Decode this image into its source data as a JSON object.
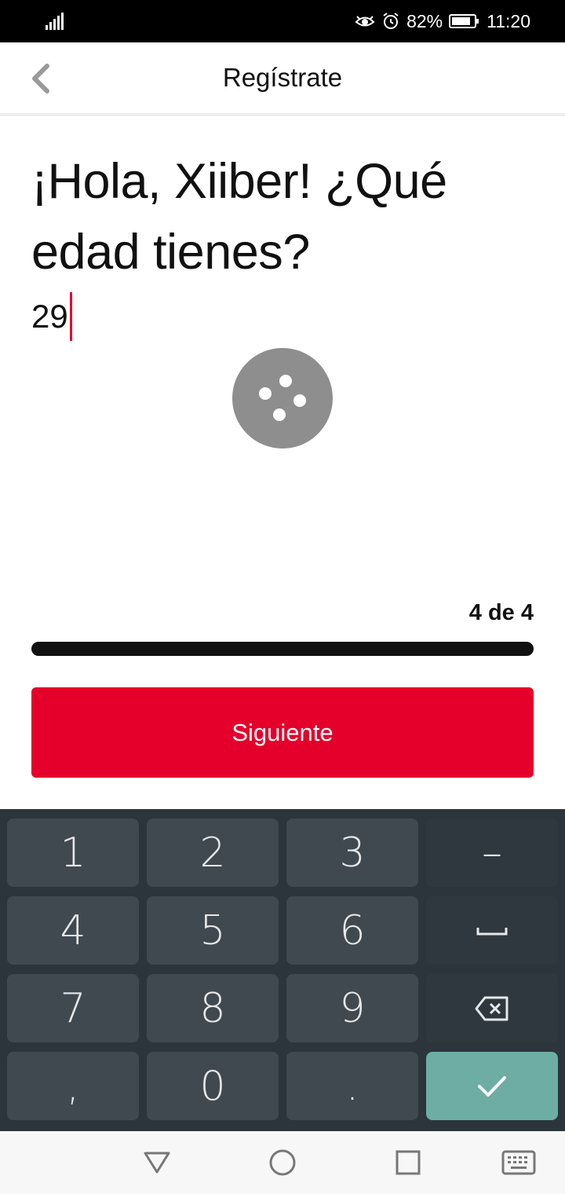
{
  "status_bar": {
    "battery": "82%",
    "time": "11:20",
    "icons": [
      "signal-icon",
      "eye-icon",
      "alarm-icon",
      "battery-icon"
    ]
  },
  "header": {
    "title": "Regístrate",
    "back_icon": "chevron-left-icon"
  },
  "form": {
    "question": "¡Hola, Xiiber! ¿Qué edad tienes?",
    "age_value": "29",
    "random_button_icon": "dice-icon"
  },
  "progress": {
    "label": "4 de 4",
    "current_step": 4,
    "total_steps": 4,
    "fraction": 1.0
  },
  "next_button": {
    "label": "Siguiente"
  },
  "keyboard": {
    "keys": [
      "1",
      "2",
      "3",
      "–",
      "4",
      "5",
      "6",
      "␣",
      "7",
      "8",
      "9",
      "⌫",
      ",",
      "0",
      ".",
      "✓"
    ],
    "icons": {
      "space": "space-icon",
      "backspace": "backspace-icon",
      "confirm": "checkmark-icon"
    }
  },
  "nav_bar": {
    "icons": [
      "back-triangle-icon",
      "home-circle-icon",
      "recents-square-icon",
      "keyboard-icon"
    ]
  },
  "colors": {
    "accent": "#e4002b",
    "keyboard_bg": "#2c353c",
    "key_bg": "#414950",
    "confirm_key": "#6dada4",
    "dice_bg": "#8e8e8e"
  }
}
